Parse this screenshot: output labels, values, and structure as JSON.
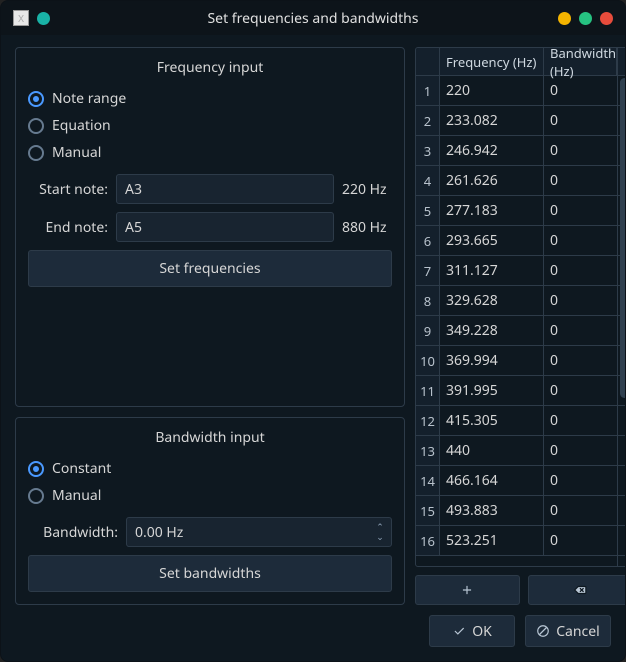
{
  "window": {
    "title": "Set frequencies and bandwidths"
  },
  "freq_panel": {
    "title": "Frequency input",
    "modes": {
      "note_range": "Note range",
      "equation": "Equation",
      "manual": "Manual",
      "selected": "note_range"
    },
    "start_label": "Start note:",
    "start_value": "A3",
    "start_hz": "220 Hz",
    "end_label": "End note:",
    "end_value": "A5",
    "end_hz": "880 Hz",
    "set_button": "Set frequencies"
  },
  "bw_panel": {
    "title": "Bandwidth input",
    "modes": {
      "constant": "Constant",
      "manual": "Manual",
      "selected": "constant"
    },
    "bw_label": "Bandwidth:",
    "bw_value": "0.00 Hz",
    "set_button": "Set bandwidths"
  },
  "table": {
    "headers": {
      "freq": "Frequency (Hz)",
      "bw": "Bandwidth (Hz)"
    },
    "rows": [
      {
        "n": "1",
        "freq": "220",
        "bw": "0"
      },
      {
        "n": "2",
        "freq": "233.082",
        "bw": "0"
      },
      {
        "n": "3",
        "freq": "246.942",
        "bw": "0"
      },
      {
        "n": "4",
        "freq": "261.626",
        "bw": "0"
      },
      {
        "n": "5",
        "freq": "277.183",
        "bw": "0"
      },
      {
        "n": "6",
        "freq": "293.665",
        "bw": "0"
      },
      {
        "n": "7",
        "freq": "311.127",
        "bw": "0"
      },
      {
        "n": "8",
        "freq": "329.628",
        "bw": "0"
      },
      {
        "n": "9",
        "freq": "349.228",
        "bw": "0"
      },
      {
        "n": "10",
        "freq": "369.994",
        "bw": "0"
      },
      {
        "n": "11",
        "freq": "391.995",
        "bw": "0"
      },
      {
        "n": "12",
        "freq": "415.305",
        "bw": "0"
      },
      {
        "n": "13",
        "freq": "440",
        "bw": "0"
      },
      {
        "n": "14",
        "freq": "466.164",
        "bw": "0"
      },
      {
        "n": "15",
        "freq": "493.883",
        "bw": "0"
      },
      {
        "n": "16",
        "freq": "523.251",
        "bw": "0"
      }
    ]
  },
  "buttons": {
    "ok": "OK",
    "cancel": "Cancel"
  },
  "traffic": {
    "min": "#f4b400",
    "max": "#26c281",
    "close": "#e74c3c"
  }
}
